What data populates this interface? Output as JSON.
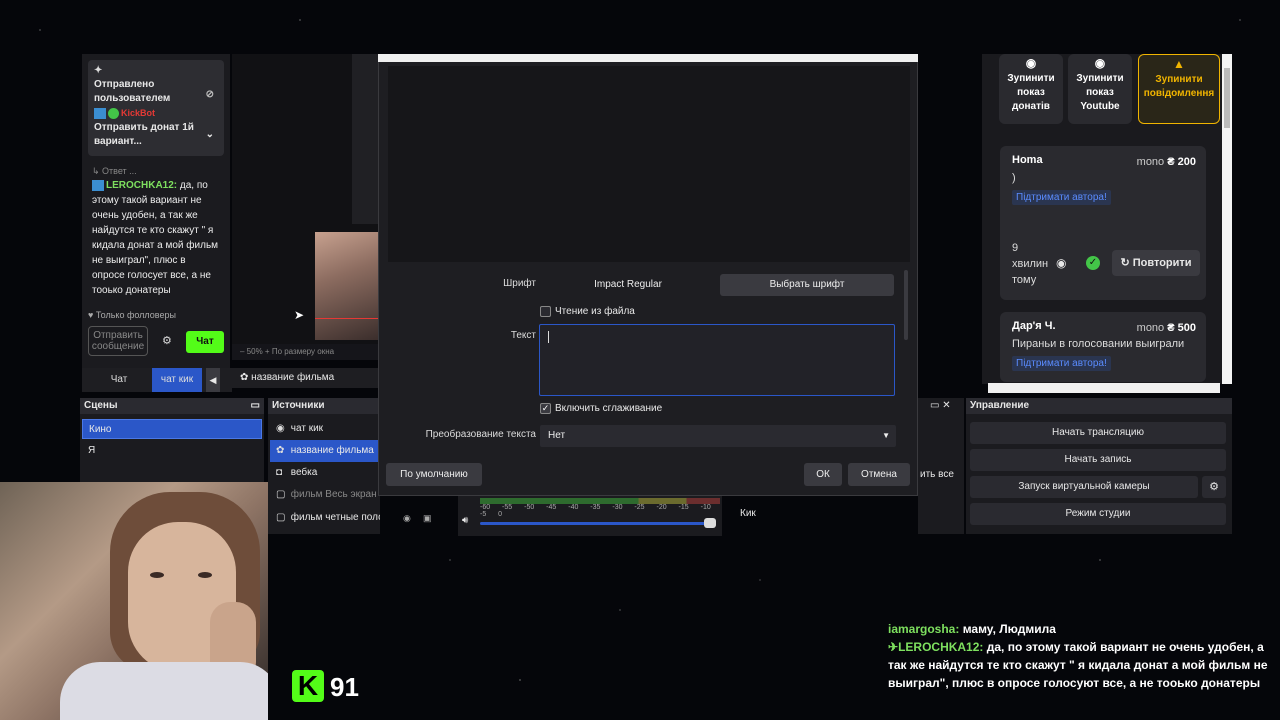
{
  "chat": {
    "pinned_label": "Отправлено пользователем",
    "pinned_bot": "KickBot",
    "pinned_text": "Отправить донат 1й вариант...",
    "reply_tag": "Ответ ...",
    "message_nick": "LEROCHKA12:",
    "message_text": " да, по этому такой вариант не очень удобен, а так же найдутся те кто скажут \" я кидала донат а мой фильм не выиграл\", плюс в опросе голосует все, а не тооько донатеры",
    "followers_only": "Только фолловеры",
    "send_placeholder": "Отправить сообщение",
    "chat_button": "Чат",
    "tabs": [
      "Чат",
      "чат кик"
    ]
  },
  "obs": {
    "zoom": "50%",
    "fit_label": "По размеру окна",
    "scene_name_bar": "название фильма",
    "scenes_title": "Сцены",
    "scenes": [
      "Кино",
      "Я"
    ],
    "sources_title": "Источники",
    "sources": [
      "чат кик",
      "название фильма",
      "вебка",
      "фильм Весь экран",
      "фильм четные полоск"
    ],
    "controls_title": "Управление",
    "controls": [
      "Начать трансляцию",
      "Начать запись",
      "Запуск виртуальной камеры",
      "Режим студии"
    ],
    "mixer_scale": "-60 -55 -50 -45 -40 -35 -30 -25 -20 -15 -10 -5 0",
    "mixer_source": "Кик",
    "all_suffix": "ить все"
  },
  "dialog": {
    "font_label": "Шрифт",
    "font_value": "Impact Regular",
    "choose_font": "Выбрать шрифт",
    "read_from_file": "Чтение из файла",
    "text_label": "Текст",
    "text_value": "",
    "antialias": "Включить сглаживание",
    "transform_label": "Преобразование текста",
    "transform_value": "Нет",
    "defaults": "По умолчанию",
    "ok": "ОК",
    "cancel": "Отмена"
  },
  "donate_panel": {
    "stop_donations": "Зупинити показ донатів",
    "stop_youtube": "Зупинити показ Youtube",
    "stop_messages": "Зупинити повідомлення",
    "donations": [
      {
        "name": "Homa",
        "currency": "mono",
        "amount": "₴ 200",
        "message": ")",
        "support": "Підтримати автора!"
      },
      {
        "name": "Дар'я Ч.",
        "currency": "mono",
        "amount": "₴ 500",
        "message": "Пираньи в голосовании выиграли",
        "support": "Підтримати автора!"
      }
    ],
    "time_ago": "9 хвилин тому",
    "repeat": "Повторити"
  },
  "stream": {
    "viewers": "91",
    "logo_letter": "K"
  },
  "overlay_chat": [
    {
      "nick": "iamargosha:",
      "text": " маму, Людмила"
    },
    {
      "nick": "LEROCHKA12:",
      "text": " да, по этому такой вариант не очень удобен, а так же найдутся те кто скажут \" я кидала донат а мой фильм не выиграл\", плюс в опросе голосуют все, а не тооько донатеры"
    }
  ],
  "colors": {
    "kick_green": "#53fc18",
    "obs_selection": "#2b57c8",
    "warn": "#f0b400",
    "link": "#5a8cff"
  }
}
